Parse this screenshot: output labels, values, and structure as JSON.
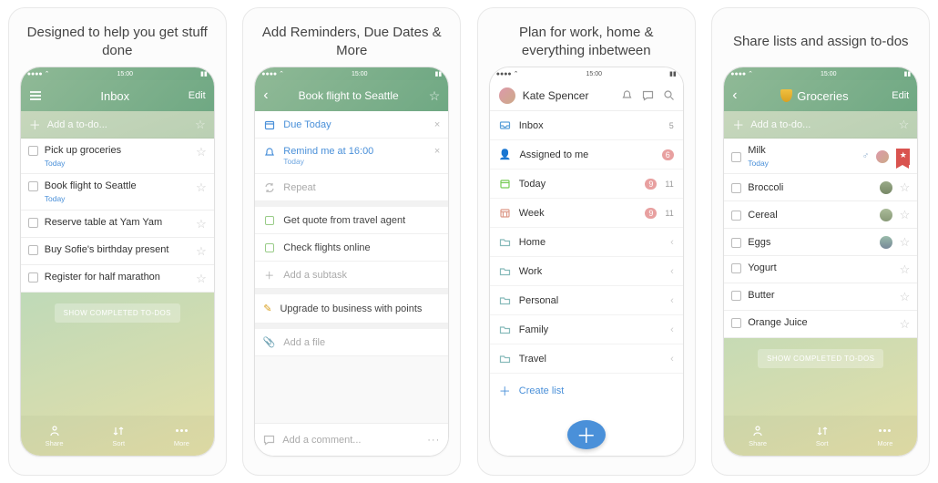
{
  "time": "15:00",
  "screens": [
    {
      "caption": "Designed to help you get stuff done",
      "title": "Inbox",
      "edit": "Edit",
      "add_placeholder": "Add a to-do...",
      "show_completed": "SHOW COMPLETED TO-DOS",
      "toolbar": {
        "share": "Share",
        "sort": "Sort",
        "more": "More"
      },
      "todos": [
        {
          "title": "Pick up groceries",
          "sub": "Today"
        },
        {
          "title": "Book flight to Seattle",
          "sub": "Today"
        },
        {
          "title": "Reserve table at Yam Yam"
        },
        {
          "title": "Buy Sofie's birthday present"
        },
        {
          "title": "Register for half marathon"
        }
      ]
    },
    {
      "caption": "Add Reminders, Due Dates & More",
      "title": "Book flight to Seattle",
      "due": "Due Today",
      "remind": "Remind me at 16:00",
      "remind_sub": "Today",
      "repeat": "Repeat",
      "subtasks": [
        "Get quote from travel agent",
        "Check flights online"
      ],
      "add_subtask": "Add a subtask",
      "note": "Upgrade to business with points",
      "add_file": "Add a file",
      "add_comment": "Add a comment..."
    },
    {
      "caption": "Plan for work, home & everything inbetween",
      "user": "Kate Spencer",
      "create": "Create list",
      "lists": [
        {
          "icon": "inbox",
          "label": "Inbox",
          "count": "5"
        },
        {
          "icon": "assigned",
          "label": "Assigned to me",
          "badge": "6"
        },
        {
          "icon": "today",
          "label": "Today",
          "badge": "9",
          "count": "11"
        },
        {
          "icon": "week",
          "label": "Week",
          "badge": "9",
          "count": "11"
        },
        {
          "icon": "folder",
          "label": "Home",
          "chev": true
        },
        {
          "icon": "folder",
          "label": "Work",
          "chev": true
        },
        {
          "icon": "folder",
          "label": "Personal",
          "chev": true
        },
        {
          "icon": "folder",
          "label": "Family",
          "chev": true
        },
        {
          "icon": "folder",
          "label": "Travel",
          "chev": true
        }
      ]
    },
    {
      "caption": "Share lists and assign to-dos",
      "title": "Groceries",
      "edit": "Edit",
      "add_placeholder": "Add a to-do...",
      "show_completed": "SHOW COMPLETED TO-DOS",
      "toolbar": {
        "share": "Share",
        "sort": "Sort",
        "more": "More"
      },
      "items": [
        {
          "title": "Milk",
          "sub": "Today",
          "assigned": true,
          "starred": true
        },
        {
          "title": "Broccoli",
          "avatar": true
        },
        {
          "title": "Cereal",
          "avatar": true
        },
        {
          "title": "Eggs",
          "avatar": true
        },
        {
          "title": "Yogurt"
        },
        {
          "title": "Butter"
        },
        {
          "title": "Orange Juice"
        }
      ]
    }
  ]
}
